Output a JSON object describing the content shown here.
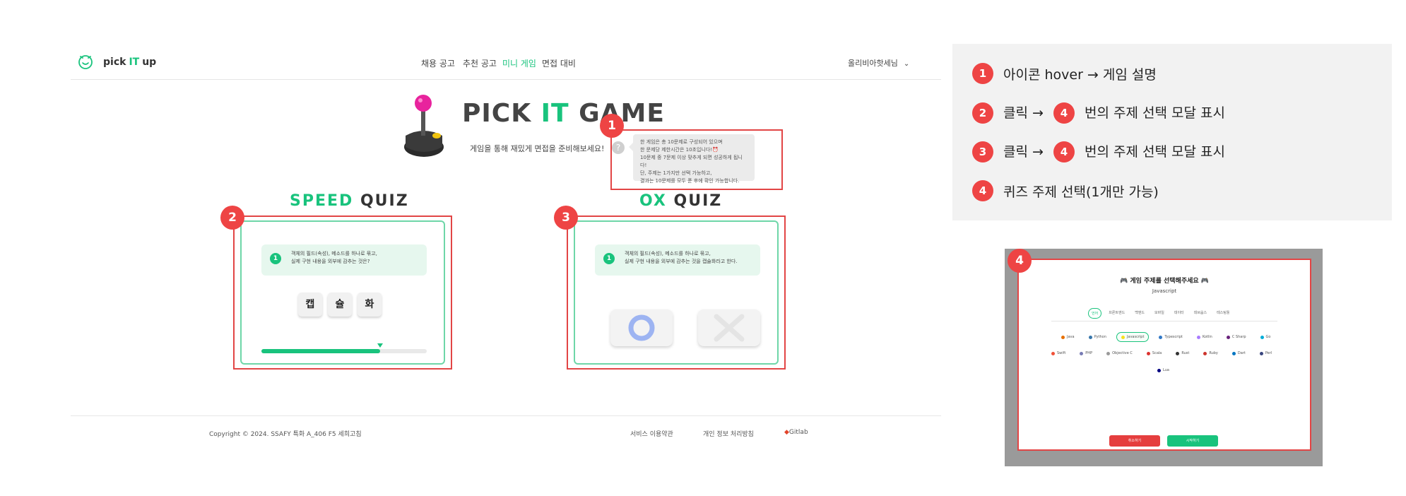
{
  "header": {
    "logo_text_pre": "pick",
    "logo_text_it": "IT",
    "logo_text_post": "up",
    "nav": [
      {
        "label": "채용 공고",
        "active": false
      },
      {
        "label": "추천 공고",
        "active": false
      },
      {
        "label": "미니 게임",
        "active": true
      },
      {
        "label": "면접 대비",
        "active": false
      }
    ],
    "user_label": "올리비아핫세님"
  },
  "hero": {
    "title_pre": "PICK ",
    "title_it": "IT",
    "title_post": " GAME",
    "subtitle": "게임을 통해 재밌게 면접을 준비해보세요!",
    "help_icon_glyph": "?",
    "tooltip_lines": [
      "한 게임은 총 10문제로 구성되어 있으며",
      "한 문제당 제한시간은 10초입니다!⏰",
      "10문제 중 7문제 이상 맞추게 되면 성공하게 됩니다!",
      "단, 주제는 1가지만 선택 가능하고,",
      "결과는 10문제를 모두 푼 후에 확인 가능합니다."
    ]
  },
  "speed_quiz": {
    "title_accent": "SPEED",
    "title_rest": " QUIZ",
    "question_number": "1",
    "question_line1": "객체의 필드(속성), 메소드를 하나로 묶고,",
    "question_line2": "실제 구현 내용을 외부에 감추는 것은?",
    "tiles": [
      "캡",
      "슐",
      "화"
    ],
    "timer_progress": 0.72
  },
  "ox_quiz": {
    "title_accent": "OX",
    "title_rest": " QUIZ",
    "question_number": "1",
    "question_line1": "객체의 필드(속성), 메소드를 하나로 묶고,",
    "question_line2": "실제 구현 내용을 외부에 감추는 것을 캡슐화라고 한다."
  },
  "annotations": {
    "badge_1": "1",
    "badge_2": "2",
    "badge_3": "3",
    "badge_4": "4"
  },
  "footer": {
    "copyright": "Copyright © 2024. SSAFY 특화 A_406 F5 세희고침",
    "terms": "서비스 이용약관",
    "privacy": "개인 정보 처리방침",
    "gitlab": "Gitlab"
  },
  "legend": {
    "row1_text": "아이콘 hover → 게임 설명",
    "row2_pre": "클릭 →",
    "row2_post": "번의 주제 선택 모달 표시",
    "row3_pre": "클릭 →",
    "row3_post": "번의 주제 선택 모달 표시",
    "row4_text": "퀴즈 주제 선택(1개만 가능)"
  },
  "modal": {
    "title": "🎮 게임 주제를 선택해주세요 🎮",
    "selected_topic": "Javascript",
    "categories": [
      {
        "label": "언어",
        "selected": true
      },
      {
        "label": "프론트엔드",
        "selected": false
      },
      {
        "label": "백엔드",
        "selected": false
      },
      {
        "label": "모바일",
        "selected": false
      },
      {
        "label": "데이터",
        "selected": false
      },
      {
        "label": "데브옵스",
        "selected": false
      },
      {
        "label": "테스팅툴",
        "selected": false
      }
    ],
    "languages_row1": [
      {
        "label": "Java",
        "color": "#e76f00",
        "selected": false
      },
      {
        "label": "Python",
        "color": "#3776ab",
        "selected": false
      },
      {
        "label": "Javascript",
        "color": "#f7df1e",
        "selected": true
      },
      {
        "label": "Typescript",
        "color": "#3178c6",
        "selected": false
      },
      {
        "label": "Kotlin",
        "color": "#a97bff",
        "selected": false
      },
      {
        "label": "C Sharp",
        "color": "#68217a",
        "selected": false
      },
      {
        "label": "Go",
        "color": "#00add8",
        "selected": false
      }
    ],
    "languages_row2": [
      {
        "label": "Swift",
        "color": "#f05138",
        "selected": false
      },
      {
        "label": "PHP",
        "color": "#777bb4",
        "selected": false
      },
      {
        "label": "Objective C",
        "color": "#999999",
        "selected": false
      },
      {
        "label": "Scala",
        "color": "#dc322f",
        "selected": false
      },
      {
        "label": "Rust",
        "color": "#333333",
        "selected": false
      },
      {
        "label": "Ruby",
        "color": "#cc342d",
        "selected": false
      },
      {
        "label": "Dart",
        "color": "#0175c2",
        "selected": false
      },
      {
        "label": "Perl",
        "color": "#39457e",
        "selected": false
      }
    ],
    "languages_row3": [
      {
        "label": "Lua",
        "color": "#000080",
        "selected": false
      }
    ],
    "cancel_label": "취소하기",
    "start_label": "시작하기"
  },
  "colors": {
    "accent": "#19c37d",
    "annotation_red": "#ee4444"
  }
}
